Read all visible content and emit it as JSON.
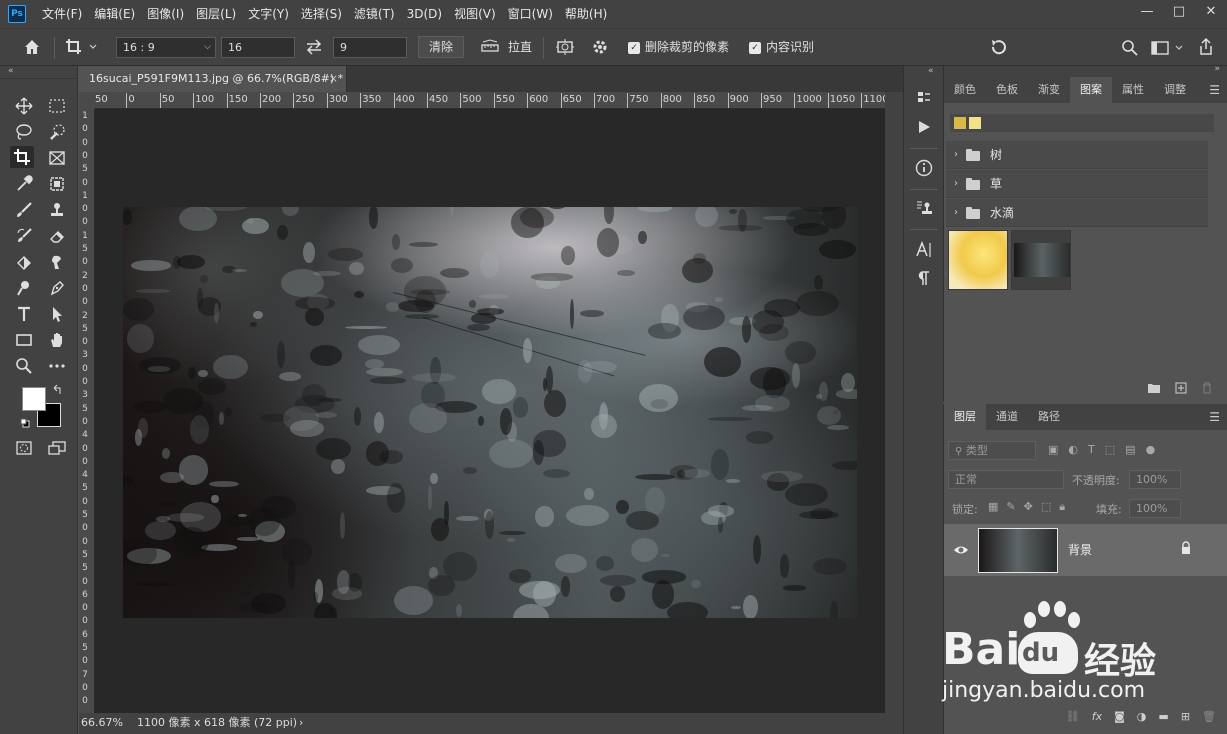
{
  "app": {
    "logo": "Ps",
    "menu": [
      "文件(F)",
      "编辑(E)",
      "图像(I)",
      "图层(L)",
      "文字(Y)",
      "选择(S)",
      "滤镜(T)",
      "3D(D)",
      "视图(V)",
      "窗口(W)",
      "帮助(H)"
    ],
    "window_controls": [
      "—",
      "□",
      "✕"
    ]
  },
  "options_bar": {
    "ratio_select": "16 : 9",
    "width_value": "16",
    "height_value": "9",
    "clear_button": "清除",
    "straighten_label": "拉直",
    "delete_pixels_label": "删除裁剪的像素",
    "content_aware_label": "内容识别"
  },
  "document": {
    "tab_title": "16sucai_P591F9M113.jpg @ 66.7%(RGB/8#) *",
    "close": "×",
    "ruler_top": [
      "50",
      "0",
      "50",
      "100",
      "150",
      "200",
      "250",
      "300",
      "350",
      "400",
      "450",
      "500",
      "550",
      "600",
      "650",
      "700",
      "750",
      "800",
      "850",
      "900",
      "950",
      "1000",
      "1050",
      "1100"
    ],
    "ruler_left": [
      "1",
      "0",
      "0",
      "0",
      "5",
      "0",
      "1",
      "0",
      "0",
      "1",
      "5",
      "0",
      "2",
      "0",
      "0",
      "2",
      "5",
      "0",
      "3",
      "0",
      "0",
      "3",
      "5",
      "0",
      "4",
      "0",
      "0",
      "4",
      "5",
      "0",
      "5",
      "0",
      "0",
      "5",
      "5",
      "0",
      "6",
      "0",
      "0",
      "6",
      "5",
      "0",
      "7",
      "0",
      "0"
    ]
  },
  "status_bar": {
    "zoom": "66.67%",
    "info": "1100 像素 x 618 像素 (72 ppi)",
    "arrow": "›"
  },
  "patterns_panel": {
    "tabs": [
      "颜色",
      "色板",
      "渐变",
      "图案",
      "属性",
      "调整"
    ],
    "active_tab": "图案",
    "groups": [
      "树",
      "草",
      "水滴"
    ]
  },
  "layers_panel": {
    "tabs": [
      "图层",
      "通道",
      "路径"
    ],
    "active_tab": "图层",
    "filter_kind": "类型",
    "blend_mode": "正常",
    "opacity_label": "不透明度:",
    "opacity_value": "100%",
    "lock_label": "锁定:",
    "fill_label": "填充:",
    "fill_value": "100%",
    "layer_name": "背景"
  },
  "watermark": {
    "brand": "Bai",
    "brand2": "du",
    "cn": "经验",
    "url": "jingyan.baidu.com"
  },
  "colors": {
    "ps_blue": "#31a8ff",
    "panel_bg": "#535353",
    "bar_bg": "#424242",
    "canvas_bg": "#282828"
  }
}
